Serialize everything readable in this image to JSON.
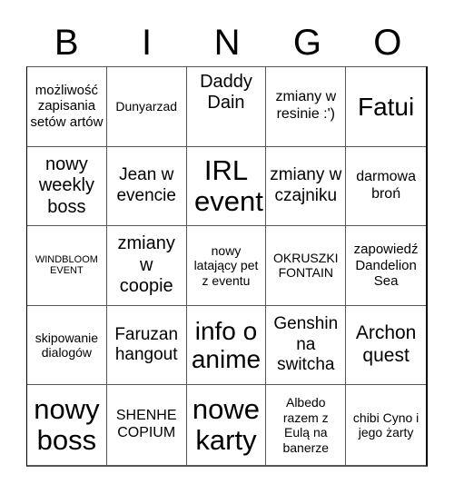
{
  "header": {
    "letters": [
      "B",
      "I",
      "N",
      "G",
      "O"
    ]
  },
  "cells": [
    {
      "text": "możliwość zapisania setów artów"
    },
    {
      "text": "Dunyarzad"
    },
    {
      "text": "Daddy Dain"
    },
    {
      "text": "zmiany w resinie :')"
    },
    {
      "text": "Fatui"
    },
    {
      "text": "nowy weekly boss"
    },
    {
      "text": "Jean w evencie"
    },
    {
      "text": "IRL event"
    },
    {
      "text": "zmiany w czajniku"
    },
    {
      "text": "darmowa broń"
    },
    {
      "text": "WINDBLOOM EVENT"
    },
    {
      "text": "zmiany w coopie"
    },
    {
      "text": "nowy latający pet z eventu"
    },
    {
      "text": "OKRUSZKI FONTAIN"
    },
    {
      "text": "zapowiedź Dandelion Sea"
    },
    {
      "text": "skipowanie dialogów"
    },
    {
      "text": "Faruzan hangout"
    },
    {
      "text": "info o anime"
    },
    {
      "text": "Genshin na switcha"
    },
    {
      "text": "Archon quest"
    },
    {
      "text": "nowy boss"
    },
    {
      "text": "SHENHE COPIUM"
    },
    {
      "text": "nowe karty"
    },
    {
      "text": "Albedo razem z Eulą na banerze"
    },
    {
      "text": "chibi Cyno i jego żarty"
    }
  ]
}
